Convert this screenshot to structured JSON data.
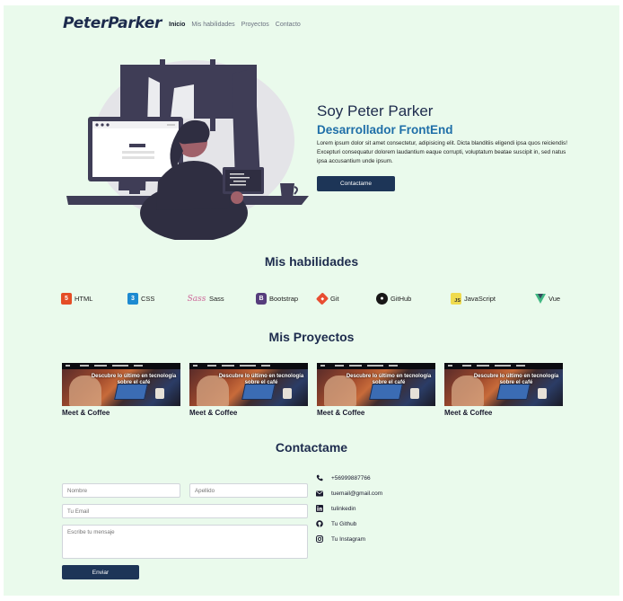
{
  "navbar": {
    "brand": "PeterParker",
    "links": [
      "Inicio",
      "Mis habilidades",
      "Proyectos",
      "Contacto"
    ]
  },
  "hero": {
    "title": "Soy Peter Parker",
    "subtitle": "Desarrollador FrontEnd",
    "description": "Lorem ipsum dolor sit amet consectetur, adipisicing elit. Dicta blanditiis eligendi ipsa quos reiciendis! Excepturi consequatur dolorem laudantium eaque corrupti, voluptatum beatae suscipit in, sed natus ipsa accusantium unde ipsum.",
    "button": "Contactame"
  },
  "skills": {
    "title": "Mis habilidades",
    "items": [
      {
        "label": "HTML",
        "icon": "html5-icon",
        "color": "#e44d26"
      },
      {
        "label": "CSS",
        "icon": "css3-icon",
        "color": "#1d8ad1"
      },
      {
        "label": "Sass",
        "icon": "sass-icon",
        "color": "#cd6799"
      },
      {
        "label": "Bootstrap",
        "icon": "bootstrap-icon",
        "color": "#563d7c"
      },
      {
        "label": "Git",
        "icon": "git-icon",
        "color": "#e84d31"
      },
      {
        "label": "GitHub",
        "icon": "github-icon",
        "color": "#181717"
      },
      {
        "label": "JavaScript",
        "icon": "javascript-icon",
        "color": "#f0db4f"
      },
      {
        "label": "Vue",
        "icon": "vue-icon",
        "color": "#41b883"
      }
    ]
  },
  "projects": {
    "title": "Mis Proyectos",
    "items": [
      {
        "name": "Meet & Coffee",
        "overlay": "Descubre lo último en tecnología sobre el café"
      },
      {
        "name": "Meet & Coffee",
        "overlay": "Descubre lo último en tecnología sobre el café"
      },
      {
        "name": "Meet & Coffee",
        "overlay": "Descubre lo último en tecnología sobre el café"
      },
      {
        "name": "Meet & Coffee",
        "overlay": "Descubre lo último en tecnología sobre el café"
      }
    ]
  },
  "contact": {
    "title": "Contactame",
    "form": {
      "nombre_placeholder": "Nombre",
      "apellido_placeholder": "Apellido",
      "email_placeholder": "Tu Email",
      "mensaje_placeholder": "Escribe tu mensaje",
      "send": "Enviar"
    },
    "info": [
      {
        "text": "+56999887766",
        "icon": "phone-icon"
      },
      {
        "text": "tuemail@gmail.com",
        "icon": "envelope-icon"
      },
      {
        "text": "tulinkedin",
        "icon": "linkedin-icon"
      },
      {
        "text": "Tu Github",
        "icon": "github-icon"
      },
      {
        "text": "Tu Instagram",
        "icon": "instagram-icon"
      }
    ]
  }
}
